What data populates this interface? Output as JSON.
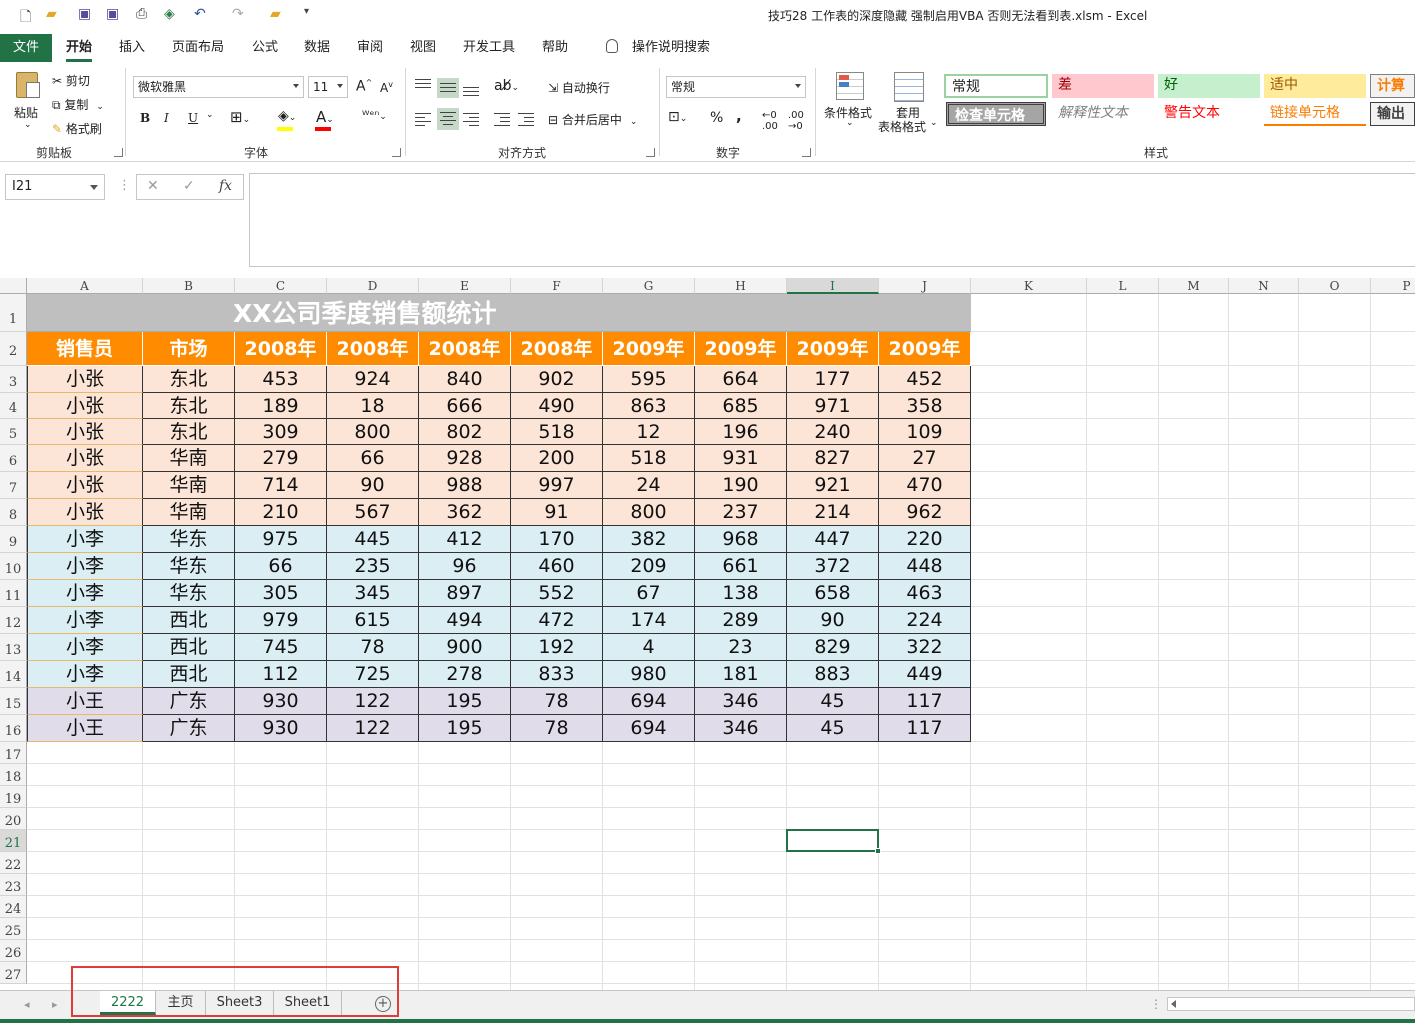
{
  "window": {
    "title": "技巧28 工作表的深度隐藏 强制启用VBA 否则无法看到表.xlsm  -  Excel"
  },
  "menu": {
    "file": "文件",
    "tabs": [
      "开始",
      "插入",
      "页面布局",
      "公式",
      "数据",
      "审阅",
      "视图",
      "开发工具",
      "帮助"
    ],
    "active_tab": "开始",
    "tell_me": "操作说明搜索"
  },
  "ribbon": {
    "clipboard": {
      "paste": "粘贴",
      "cut": "剪切",
      "copy": "复制",
      "format_painter": "格式刷",
      "label": "剪贴板"
    },
    "font": {
      "name": "微软雅黑",
      "size": "11",
      "bold": "B",
      "italic": "I",
      "underline": "U",
      "label": "字体"
    },
    "alignment": {
      "wrap": "自动换行",
      "merge": "合并后居中",
      "label": "对齐方式"
    },
    "number": {
      "format": "常规",
      "percent": "%",
      "comma": ",",
      "label": "数字"
    },
    "styles": {
      "conditional": "条件格式",
      "table1": "套用",
      "table2": "表格格式",
      "label": "样式",
      "cells": [
        {
          "text": "常规",
          "bg": "#ffffff",
          "color": "#000000",
          "border": "#9bd3a0"
        },
        {
          "text": "差",
          "bg": "#ffc7ce",
          "color": "#9c0006",
          "border": "#ffc7ce"
        },
        {
          "text": "好",
          "bg": "#c6efce",
          "color": "#006100",
          "border": "#c6efce"
        },
        {
          "text": "适中",
          "bg": "#ffeb9c",
          "color": "#9c5700",
          "border": "#ffeb9c"
        },
        {
          "text": "计算",
          "bg": "#f2f2f2",
          "color": "#fa7d00",
          "border": "#7f7f7f"
        },
        {
          "text": "检查单元格",
          "bg": "#a5a5a5",
          "color": "#ffffff",
          "border": "#3f3f3f"
        },
        {
          "text": "解释性文本",
          "bg": "#ffffff",
          "color": "#7f7f7f",
          "border": "#ffffff"
        },
        {
          "text": "警告文本",
          "bg": "#ffffff",
          "color": "#ff0000",
          "border": "#ffffff"
        },
        {
          "text": "链接单元格",
          "bg": "#ffffff",
          "color": "#fa7d00",
          "border": "#ffffff"
        },
        {
          "text": "输出",
          "bg": "#f2f2f2",
          "color": "#3f3f3f",
          "border": "#3f3f3f"
        }
      ]
    }
  },
  "formula_bar": {
    "name_box": "I21",
    "cancel": "✕",
    "enter": "✓",
    "fx": "fx",
    "value": ""
  },
  "sheet": {
    "columns": [
      "A",
      "B",
      "C",
      "D",
      "E",
      "F",
      "G",
      "H",
      "I",
      "J",
      "K",
      "L",
      "M",
      "N",
      "O",
      "P"
    ],
    "selected_column": "I",
    "selected_row": "21",
    "rows": [
      "1",
      "2",
      "3",
      "4",
      "5",
      "6",
      "7",
      "8",
      "9",
      "10",
      "11",
      "12",
      "13",
      "14",
      "15",
      "16",
      "17",
      "18",
      "19",
      "20",
      "21",
      "22",
      "23",
      "24",
      "25",
      "26",
      "27"
    ],
    "title": "XX公司季度销售额统计",
    "headers": [
      "销售员",
      "市场",
      "2008年",
      "2008年",
      "2008年",
      "2008年",
      "2009年",
      "2009年",
      "2009年",
      "2009年"
    ],
    "data": [
      [
        "小张",
        "东北",
        "453",
        "924",
        "840",
        "902",
        "595",
        "664",
        "177",
        "452"
      ],
      [
        "小张",
        "东北",
        "189",
        "18",
        "666",
        "490",
        "863",
        "685",
        "971",
        "358"
      ],
      [
        "小张",
        "东北",
        "309",
        "800",
        "802",
        "518",
        "12",
        "196",
        "240",
        "109"
      ],
      [
        "小张",
        "华南",
        "279",
        "66",
        "928",
        "200",
        "518",
        "931",
        "827",
        "27"
      ],
      [
        "小张",
        "华南",
        "714",
        "90",
        "988",
        "997",
        "24",
        "190",
        "921",
        "470"
      ],
      [
        "小张",
        "华南",
        "210",
        "567",
        "362",
        "91",
        "800",
        "237",
        "214",
        "962"
      ],
      [
        "小李",
        "华东",
        "975",
        "445",
        "412",
        "170",
        "382",
        "968",
        "447",
        "220"
      ],
      [
        "小李",
        "华东",
        "66",
        "235",
        "96",
        "460",
        "209",
        "661",
        "372",
        "448"
      ],
      [
        "小李",
        "华东",
        "305",
        "345",
        "897",
        "552",
        "67",
        "138",
        "658",
        "463"
      ],
      [
        "小李",
        "西北",
        "979",
        "615",
        "494",
        "472",
        "174",
        "289",
        "90",
        "224"
      ],
      [
        "小李",
        "西北",
        "745",
        "78",
        "900",
        "192",
        "4",
        "23",
        "829",
        "322"
      ],
      [
        "小李",
        "西北",
        "112",
        "725",
        "278",
        "833",
        "980",
        "181",
        "883",
        "449"
      ],
      [
        "小王",
        "广东",
        "930",
        "122",
        "195",
        "78",
        "694",
        "346",
        "45",
        "117"
      ],
      [
        "小王",
        "广东",
        "930",
        "122",
        "195",
        "78",
        "694",
        "346",
        "45",
        "117"
      ]
    ]
  },
  "sheet_tabs": {
    "tabs": [
      "2222",
      "主页",
      "Sheet3",
      "Sheet1"
    ],
    "active": "2222",
    "add": "+"
  },
  "colors": {
    "accent": "#217346",
    "header_orange": "#ff8c00",
    "highlight_red": "#e03a3a"
  }
}
